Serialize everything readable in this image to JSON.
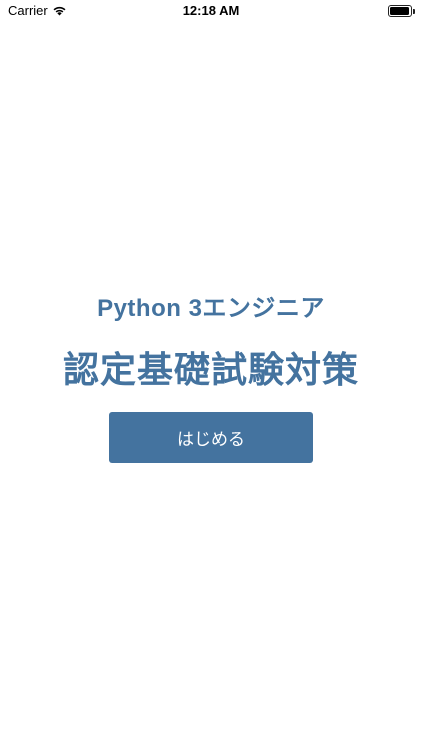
{
  "status_bar": {
    "carrier": "Carrier",
    "time": "12:18 AM",
    "wifi_icon": "wifi-icon",
    "battery_icon": "battery-icon",
    "battery_level": 1.0
  },
  "main": {
    "headline": "Python 3エンジニア",
    "title": "認定基礎試験対策",
    "start_button_label": "はじめる"
  },
  "colors": {
    "accent": "#44739f",
    "background": "#ffffff",
    "button_text": "#ffffff"
  }
}
